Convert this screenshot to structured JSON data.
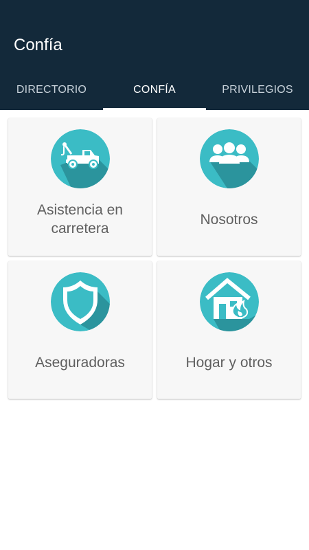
{
  "app": {
    "title": "Confía"
  },
  "tabs": [
    {
      "label": "DIRECTORIO",
      "active": false
    },
    {
      "label": "CONFÍA",
      "active": true
    },
    {
      "label": "PRIVILEGIOS",
      "active": false
    }
  ],
  "cards": [
    {
      "label": "Asistencia en carretera",
      "icon": "tow-truck-icon"
    },
    {
      "label": "Nosotros",
      "icon": "group-icon"
    },
    {
      "label": "Aseguradoras",
      "icon": "shield-icon"
    },
    {
      "label": "Hogar y otros",
      "icon": "house-fire-icon"
    }
  ],
  "colors": {
    "appbar": "#13293a",
    "icon_circle": "#3bbcc5",
    "icon_shadow": "#2a8f98",
    "card_background": "#f7f7f7",
    "label_text": "#5f5f5f"
  }
}
